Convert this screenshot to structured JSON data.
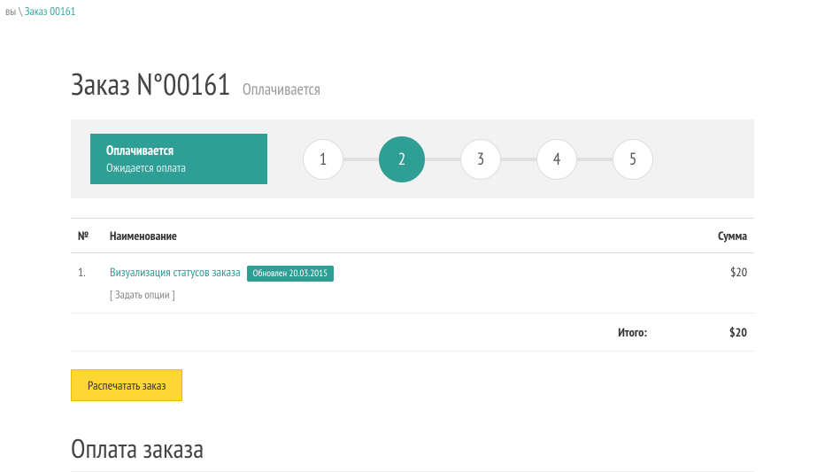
{
  "breadcrumb": {
    "prefix": "вы",
    "sep": " \\ ",
    "current": "Заказ 00161"
  },
  "title": {
    "main": "Заказ N°00161",
    "status": "Оплачивается"
  },
  "status_box": {
    "title": "Оплачивается",
    "sub": "Ожидается оплата"
  },
  "steps": {
    "items": [
      "1",
      "2",
      "3",
      "4",
      "5"
    ],
    "active_index": 1
  },
  "table": {
    "headers": {
      "no": "№",
      "name": "Наименование",
      "amount": "Сумма"
    },
    "rows": [
      {
        "no": "1.",
        "name": "Визуализация статусов заказа",
        "badge": "Обновлен 20.03.2015",
        "options": "[ Задать опции ]",
        "amount": "$20"
      }
    ],
    "total": {
      "label": "Итого:",
      "amount": "$20"
    }
  },
  "print_button": "Распечатать заказ",
  "payment_section_title": "Оплата заказа"
}
